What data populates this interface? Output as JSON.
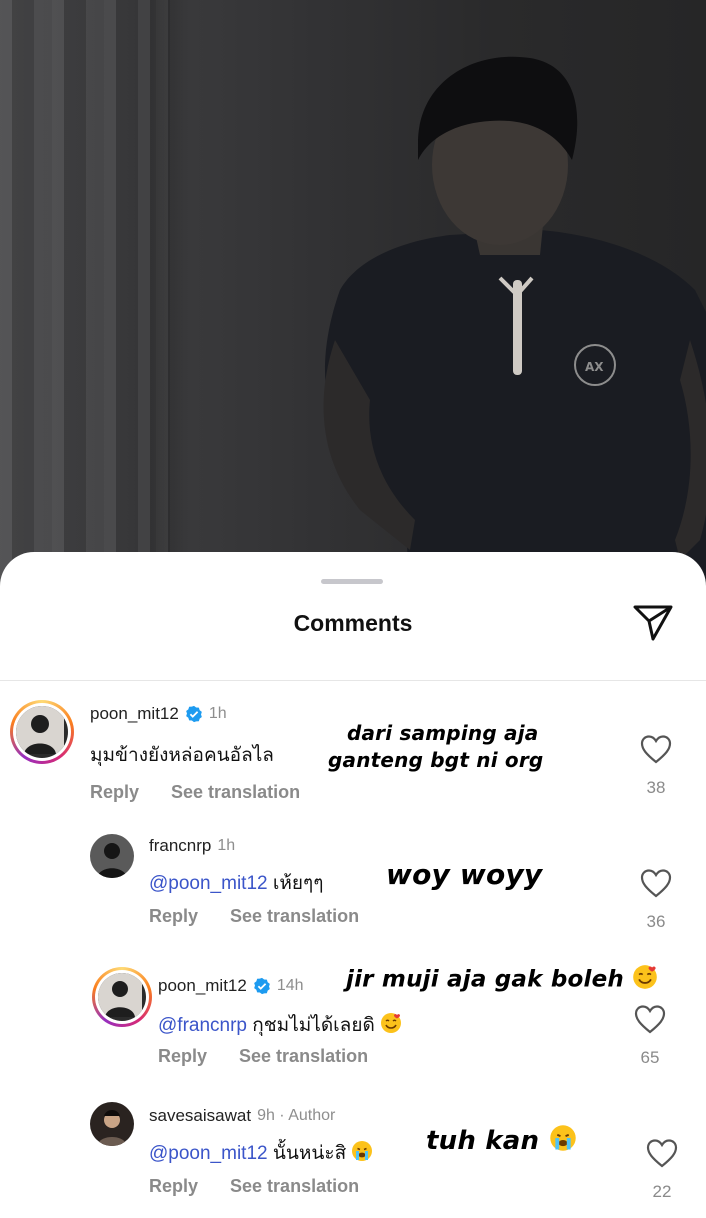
{
  "sheet": {
    "title": "Comments"
  },
  "comments": [
    {
      "username": "poon_mit12",
      "verified": true,
      "time": "1h",
      "mention": "",
      "text": "มุมข้างยังหล่อคนอัลไล",
      "reply_label": "Reply",
      "translate_label": "See translation",
      "likes": "38",
      "overlay": [
        "dari samping aja",
        "ganteng bgt ni org"
      ]
    },
    {
      "username": "francnrp",
      "verified": false,
      "time": "1h",
      "mention": "@poon_mit12",
      "text": "เห้ยๆๆ",
      "reply_label": "Reply",
      "translate_label": "See translation",
      "likes": "36",
      "overlay": [
        "woy woyy"
      ]
    },
    {
      "username": "poon_mit12",
      "verified": true,
      "time": "14h",
      "mention": "@francnrp",
      "text": "กุชมไม่ได้เลยดิ",
      "reply_label": "Reply",
      "translate_label": "See translation",
      "likes": "65",
      "overlay": [
        "jir muji aja gak boleh"
      ]
    },
    {
      "username": "savesaisawat",
      "verified": false,
      "time": "9h · Author",
      "mention": "@poon_mit12",
      "text": "นั้นหน่ะสิ",
      "reply_label": "Reply",
      "translate_label": "See translation",
      "likes": "22",
      "overlay": [
        "tuh kan"
      ]
    }
  ],
  "icons": {
    "share": "send-icon",
    "like": "heart-outline-icon",
    "verified": "verified-badge-icon"
  },
  "colors": {
    "mention": "#3b55c9",
    "verified": "#1d9bf0",
    "secondary_text": "#8e8e8e"
  }
}
